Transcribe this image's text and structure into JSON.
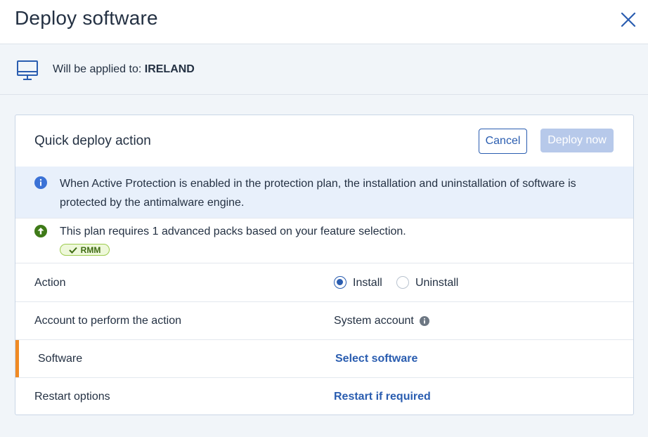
{
  "dialog": {
    "title": "Deploy software",
    "close_icon": "close-icon"
  },
  "applied": {
    "prefix": "Will be applied to:",
    "target": "IRELAND",
    "icon": "monitor-icon"
  },
  "card": {
    "title": "Quick deploy action",
    "cancel_label": "Cancel",
    "deploy_label": "Deploy now",
    "info_text": "When Active Protection is enabled in the protection plan, the installation and uninstallation of software is protected by the antimalware engine.",
    "pack_text": "This plan requires 1 advanced packs based on your feature selection.",
    "pack_badge": "RMM",
    "rows": {
      "action": {
        "label": "Action",
        "options": [
          "Install",
          "Uninstall"
        ],
        "selected": "Install"
      },
      "account": {
        "label": "Account to perform the action",
        "value": "System account"
      },
      "software": {
        "label": "Software",
        "value": "Select software"
      },
      "restart": {
        "label": "Restart options",
        "value": "Restart if required"
      }
    }
  },
  "colors": {
    "accent": "#2a5db0",
    "required_marker": "#f08a24",
    "info_bg": "#e8f0fb",
    "badge_green": "#3e6b12"
  }
}
